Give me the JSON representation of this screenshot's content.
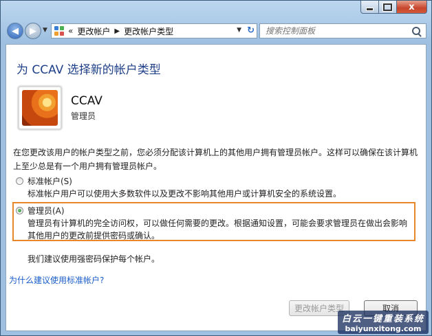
{
  "window": {
    "caption": {
      "close_glyph": "x"
    }
  },
  "nav": {
    "address": {
      "breadcrumb_prefix": "«",
      "crumbs": [
        "更改帐户",
        "更改帐户类型"
      ]
    },
    "search": {
      "placeholder": "搜索控制面板"
    }
  },
  "content": {
    "title": "为 CCAV 选择新的帐户类型",
    "user": {
      "name": "CCAV",
      "role": "管理员"
    },
    "description": "在您更改该用户的帐户类型之前，您必须分配该计算机上的其他用户拥有管理员帐户。这样可以确保在该计算机上至少总是有一个用户拥有管理员帐户。",
    "options": [
      {
        "label": "标准帐户(S)",
        "description": "标准帐户用户可以使用大多数软件以及更改不影响其他用户或计算机安全的系统设置。",
        "selected": false
      },
      {
        "label": "管理员(A)",
        "description": "管理员有计算机的完全访问权，可以做任何需要的更改。根据通知设置，可能会要求管理员在做出会影响其他用户的更改前提供密码或确认。",
        "selected": true
      }
    ],
    "recommendation": "我们建议使用强密码保护每个帐户。",
    "help_link": "为什么建议使用标准帐户?",
    "buttons": {
      "change": "更改帐户类型",
      "cancel": "取消"
    }
  },
  "watermark": {
    "line1": "白云一键重装系统",
    "line2": "baiyunxitong.com"
  },
  "colors": {
    "title": "#1e3f87",
    "link": "#1a5cc8",
    "highlight": "#e8872a"
  }
}
